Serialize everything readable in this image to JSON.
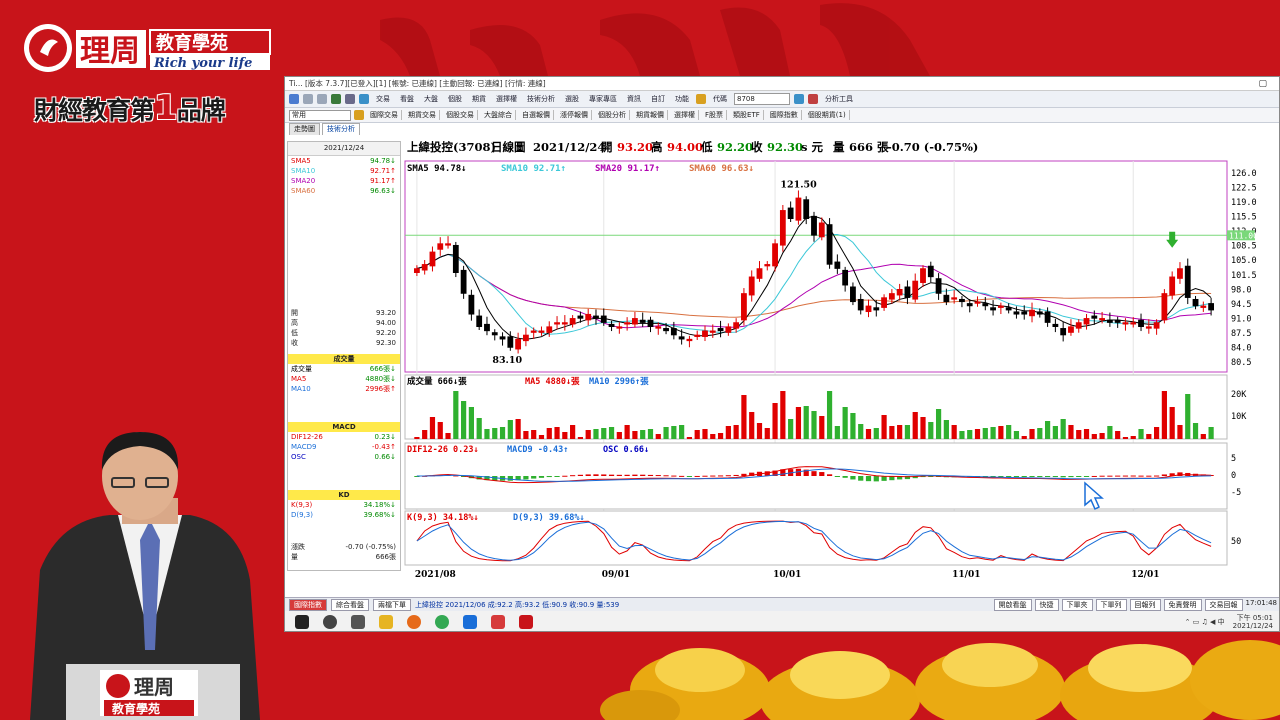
{
  "brand": {
    "logo_text": "理周",
    "logo_sub": "教育學苑",
    "logo_tagline": "Rich your life",
    "slogan_a": "財經教育第",
    "slogan_num": "1",
    "slogan_b": "品牌",
    "podium_logo": "理周",
    "podium_sub": "教育學苑"
  },
  "window": {
    "title": "Ti... [版本 7.3.7][已登入][1] [帳號: 已連線] [主動回報: 已連線]  [行情: 連線]",
    "toolbar": {
      "items": [
        "交易",
        "看盤",
        "大盤",
        "個股",
        "期貨",
        "選擇權",
        "技術分析",
        "選股",
        "專家專區",
        "資訊",
        "自訂",
        "功能"
      ],
      "stock_code_label": "代碼",
      "stock_code": "8708",
      "analysis_tools": "分析工具"
    },
    "favbar": {
      "dropdown": "常用",
      "items": [
        "國際交易",
        "期貨交易",
        "個股交易",
        "大盤綜合",
        "自選報價",
        "漲停報價",
        "個股分析",
        "期貨報價",
        "選擇權",
        "F股票",
        "類股ETF",
        "國際指數",
        "個股期貨(1)"
      ]
    },
    "tabs": [
      "走勢圖",
      "技術分析"
    ]
  },
  "left_panel": {
    "date": "2021/12/24",
    "sma": [
      {
        "label": "SMA5",
        "value": "94.78",
        "dir": "down"
      },
      {
        "label": "SMA10",
        "value": "92.71",
        "dir": "up"
      },
      {
        "label": "SMA20",
        "value": "91.17",
        "dir": "up"
      },
      {
        "label": "SMA60",
        "value": "96.63",
        "dir": "down"
      }
    ],
    "ohlc": [
      {
        "label": "開",
        "value": "93.20"
      },
      {
        "label": "高",
        "value": "94.00"
      },
      {
        "label": "低",
        "value": "92.20"
      },
      {
        "label": "收",
        "value": "92.30"
      }
    ],
    "volume_head": "成交量",
    "volume": [
      {
        "label": "成交量",
        "value": "666張",
        "dir": "down"
      },
      {
        "label": "MA5",
        "value": "4880張",
        "dir": "down"
      },
      {
        "label": "MA10",
        "value": "2996張",
        "dir": "up"
      }
    ],
    "macd_head": "MACD",
    "macd": [
      {
        "label": "DIF12-26",
        "value": "0.23",
        "dir": "down"
      },
      {
        "label": "MACD9",
        "value": "-0.43",
        "dir": "up"
      },
      {
        "label": "OSC",
        "value": "0.66",
        "dir": "down"
      }
    ],
    "kd_head": "KD",
    "kd": [
      {
        "label": "K(9,3)",
        "value": "34.18%",
        "dir": "down"
      },
      {
        "label": "D(9,3)",
        "value": "39.68%",
        "dir": "down"
      }
    ],
    "change_label": "漲跌",
    "change_value": "-0.70 (-0.75%)",
    "qty_label": "量",
    "qty_value": "666張"
  },
  "chart_header": {
    "name": "上緯投控(3708)",
    "period": "日線圖",
    "date": "2021/12/24",
    "open_label": "開",
    "open": "93.20",
    "high_label": "高",
    "high": "94.00",
    "low_label": "低",
    "low": "92.20",
    "close_label": "收",
    "close": "92.30",
    "unit": "s 元",
    "vol_label": "量",
    "vol": "666 張",
    "change": "-0.70 (-0.75%)"
  },
  "chart_data": {
    "type": "candlestick",
    "ylim": [
      80.5,
      126.0
    ],
    "y_ticks": [
      "126.0",
      "122.5",
      "119.0",
      "115.5",
      "112.0",
      "108.5",
      "105.0",
      "101.5",
      "98.0",
      "94.5",
      "91.0",
      "87.5",
      "84.0",
      "80.5"
    ],
    "x_ticks": [
      "2021/08",
      "09/01",
      "10/01",
      "11/01",
      "12/01"
    ],
    "annotations": {
      "max": "121.50",
      "min": "83.10",
      "hline": "111.00"
    },
    "legend": [
      {
        "label": "SMA5 94.78",
        "color": "#000000",
        "dir": "down"
      },
      {
        "label": "SMA10 92.71",
        "color": "#3cc8d8",
        "dir": "up"
      },
      {
        "label": "SMA20 91.17",
        "color": "#b000b0",
        "dir": "up"
      },
      {
        "label": "SMA60 96.63",
        "color": "#d87040",
        "dir": "down"
      }
    ],
    "closes": [
      103,
      104,
      107,
      109,
      109,
      102,
      97,
      92,
      89,
      88,
      87,
      86,
      84,
      86,
      87,
      88,
      88,
      89,
      90,
      90,
      91,
      91,
      92,
      91,
      90,
      89,
      89,
      90,
      91,
      90,
      89,
      89,
      88,
      87,
      86,
      86,
      87,
      88,
      88,
      88,
      89,
      90,
      97,
      101,
      103,
      104,
      109,
      117,
      115,
      120,
      115,
      111,
      114,
      104,
      103,
      99,
      95,
      93,
      94,
      93,
      96,
      97,
      98,
      96,
      100,
      103,
      101,
      97,
      95,
      96,
      95,
      94,
      95,
      94,
      93,
      94,
      93,
      92,
      92,
      93,
      92,
      90,
      89,
      87,
      89,
      90,
      91,
      91,
      91,
      90,
      90,
      90,
      90,
      89,
      89,
      90,
      97,
      101,
      103,
      96,
      94,
      94,
      93
    ],
    "volume": {
      "ylabel_ticks": [
        "20K",
        "10K"
      ],
      "legend": [
        "成交量 666",
        "MA5 4880",
        "MA10 2996"
      ],
      "legend_colors": [
        "#000000",
        "#e00000",
        "#1a6ed8"
      ],
      "legend_dirs": [
        "down",
        "down",
        "up"
      ]
    },
    "macd": {
      "ticks": [
        "5",
        "0",
        "-5"
      ],
      "legend": [
        "DIF12-26 0.23",
        "MACD9 -0.43",
        "OSC 0.66"
      ],
      "legend_colors": [
        "#e00000",
        "#1a6ed8",
        "#0000c0"
      ],
      "legend_dirs": [
        "down",
        "up",
        "down"
      ]
    },
    "kd": {
      "ticks": [
        "50"
      ],
      "legend": [
        "K(9,3) 34.18%",
        "D(9,3) 39.68%"
      ],
      "legend_colors": [
        "#e00000",
        "#1a6ed8"
      ],
      "legend_dirs": [
        "down",
        "down"
      ]
    }
  },
  "statusbar": {
    "tabs": [
      "國際指數",
      "綜合看盤",
      "兩檔下單"
    ],
    "ticker": "上緯投控 2021/12/06 成:92.2 高:93.2 低:90.9 收:90.9 量:539",
    "right": [
      "開啟看盤",
      "快捷",
      "下單夾",
      "下單列",
      "回報列",
      "免責聲明",
      "交易回報"
    ],
    "time": "17:01:48"
  },
  "taskbar": {
    "clock_time": "下午 05:01",
    "clock_date": "2021/12/24"
  },
  "colors": {
    "up": "#e00000",
    "down": "#008a00",
    "bg_red": "#c8141a",
    "gold": "#f5c21a"
  }
}
